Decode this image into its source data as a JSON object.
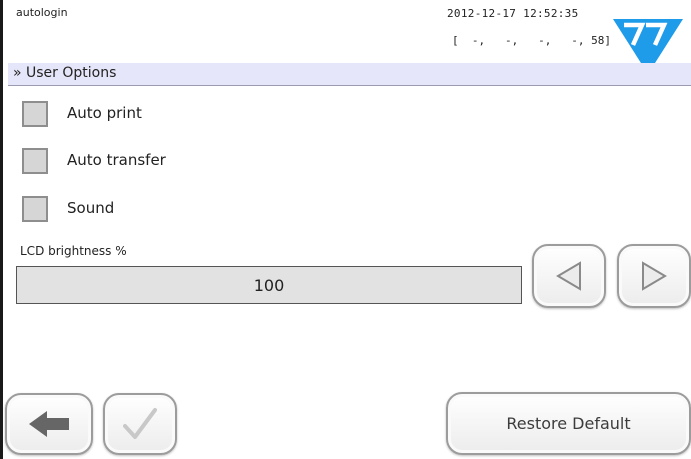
{
  "header": {
    "user": "autologin",
    "datetime": "2012-12-17 12:52:35",
    "status": "[  -,   -,   -,   -, 58]"
  },
  "menu": {
    "title": "» User Options"
  },
  "options": [
    {
      "label": "Auto print",
      "checked": false
    },
    {
      "label": "Auto transfer",
      "checked": false
    },
    {
      "label": "Sound",
      "checked": false
    }
  ],
  "lcd": {
    "label": "LCD brightness %",
    "value": "100"
  },
  "buttons": {
    "decrease_icon": "triangle-left-icon",
    "increase_icon": "triangle-right-icon",
    "back_icon": "arrow-left-icon",
    "ok_icon": "checkmark-icon",
    "restore_label": "Restore Default"
  },
  "colors": {
    "logo_blue": "#1e9be9",
    "menu_bar": "#e6e6fa"
  }
}
